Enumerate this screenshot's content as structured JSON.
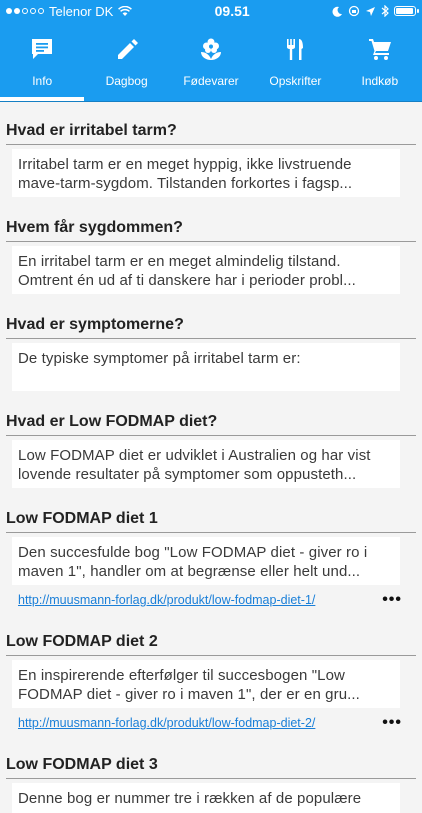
{
  "status": {
    "carrier": "Telenor DK",
    "time": "09.51"
  },
  "tabs": [
    {
      "label": "Info",
      "icon": "chat-icon",
      "active": true
    },
    {
      "label": "Dagbog",
      "icon": "pencil-icon"
    },
    {
      "label": "Fødevarer",
      "icon": "flower-icon"
    },
    {
      "label": "Opskrifter",
      "icon": "cutlery-icon"
    },
    {
      "label": "Indkøb",
      "icon": "cart-icon"
    }
  ],
  "sections": [
    {
      "title": "Hvad er irritabel tarm?",
      "lines": [
        "Irritabel tarm er en meget hyppig, ikke livstruende",
        "mave-tarm-sygdom. Tilstanden forkortes i fagsp..."
      ]
    },
    {
      "title": "Hvem får sygdommen?",
      "lines": [
        "En irritabel tarm er en meget almindelig tilstand.",
        "Omtrent én ud af ti danskere har i perioder probl..."
      ]
    },
    {
      "title": "Hvad er symptomerne?",
      "lines": [
        "De typiske symptomer på irritabel tarm er:",
        ""
      ]
    },
    {
      "title": "Hvad er Low FODMAP diet?",
      "lines": [
        "Low FODMAP diet er udviklet i Australien og har vist",
        "lovende resultater på symptomer som oppusteth..."
      ]
    },
    {
      "title": "Low FODMAP diet 1",
      "lines": [
        "Den succesfulde bog \"Low FODMAP diet - giver ro i",
        "maven 1\", handler om at begrænse eller helt und..."
      ],
      "link": "http://muusmann-forlag.dk/produkt/low-fodmap-diet-1/"
    },
    {
      "title": "Low FODMAP diet 2",
      "lines": [
        "En inspirerende efterfølger til succesbogen \"Low",
        "FODMAP diet - giver ro i maven 1\", der er en gru..."
      ],
      "link": "http://muusmann-forlag.dk/produkt/low-fodmap-diet-2/"
    },
    {
      "title": "Low FODMAP diet 3",
      "lines": [
        "Denne bog er nummer tre i rækken af de populære",
        ""
      ]
    }
  ],
  "more_label": "•••"
}
